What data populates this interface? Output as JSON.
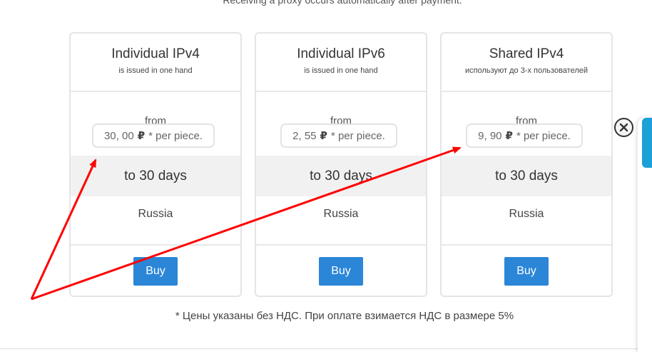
{
  "header": {
    "note": "Receiving a proxy occurs automatically after payment."
  },
  "plans": [
    {
      "title": "Individual IPv4",
      "subtitle": "is issued in one hand",
      "from": "from",
      "price": "30, 00",
      "currency": "₽",
      "unit": "* per piece.",
      "period": "to 30 days",
      "country": "Russia",
      "button": "Buy"
    },
    {
      "title": "Individual IPv6",
      "subtitle": "is issued in one hand",
      "from": "from",
      "price": "2, 55",
      "currency": "₽",
      "unit": "* per piece.",
      "period": "to 30 days",
      "country": "Russia",
      "button": "Buy"
    },
    {
      "title": "Shared IPv4",
      "subtitle": "используют до 3-х пользователей",
      "from": "from",
      "price": "9, 90",
      "currency": "₽",
      "unit": "* per piece.",
      "period": "to 30 days",
      "country": "Russia",
      "button": "Buy"
    }
  ],
  "footer": {
    "vat_note": "* Цены указаны без НДС. При оплате взимается НДС в размере 5%"
  },
  "widget": {
    "close_icon": "close-circle-icon",
    "tab_color": "#1ba0d8"
  },
  "colors": {
    "button": "#2b86d8",
    "annotation": "#ff0000",
    "period_bg": "#f1f1f1"
  }
}
